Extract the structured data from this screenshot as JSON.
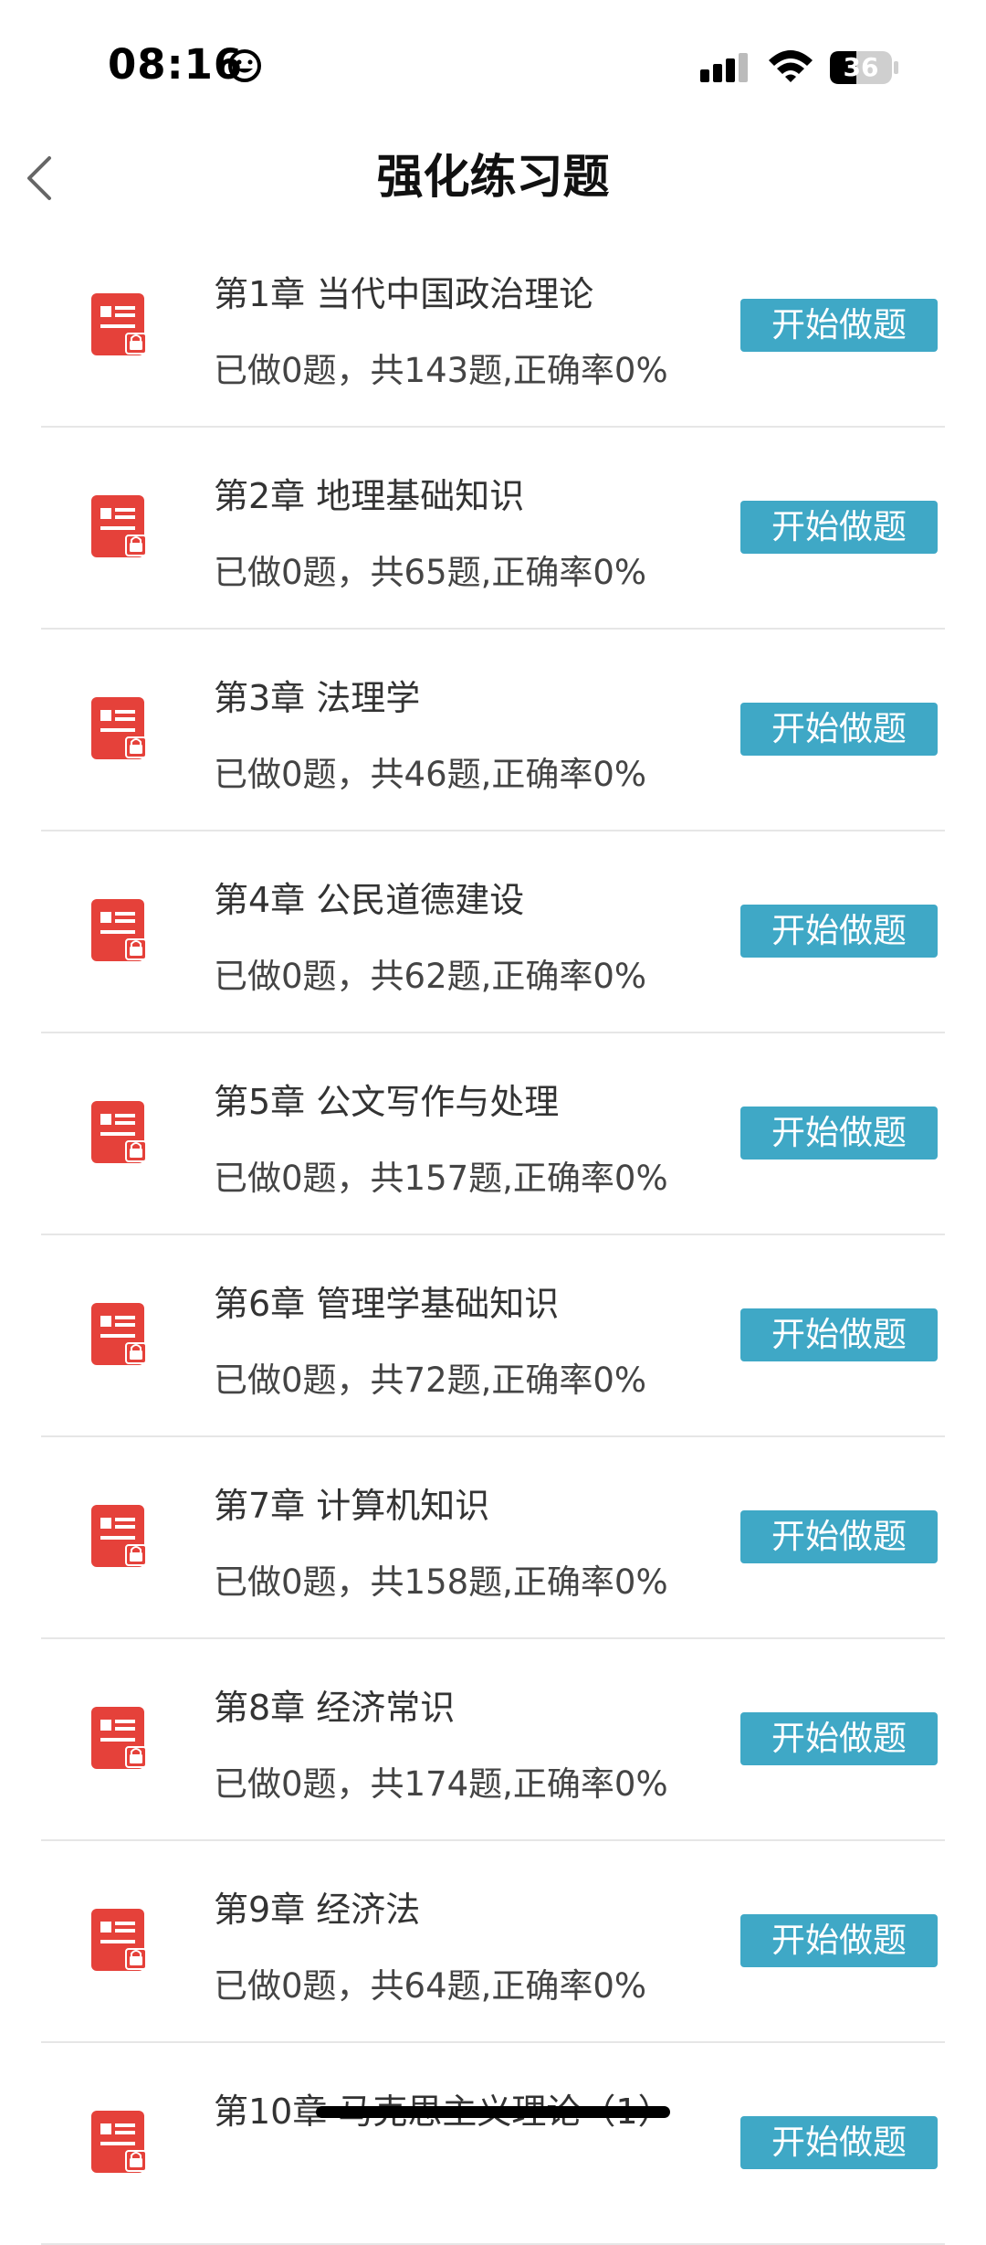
{
  "status_bar": {
    "time": "08:16",
    "battery_level": "36",
    "icons": [
      "smiley-icon",
      "cellular-signal-icon",
      "wifi-icon",
      "battery-icon"
    ]
  },
  "header": {
    "title": "强化练习题",
    "back_icon": "chevron-left-icon"
  },
  "colors": {
    "accent_button": "#3fa8c6",
    "icon_red": "#e5413a"
  },
  "chapters": [
    {
      "title": "第1章  当代中国政治理论",
      "stats": "已做0题，共143题,正确率0%",
      "button": "开始做题"
    },
    {
      "title": "第2章  地理基础知识",
      "stats": "已做0题，共65题,正确率0%",
      "button": "开始做题"
    },
    {
      "title": "第3章  法理学",
      "stats": "已做0题，共46题,正确率0%",
      "button": "开始做题"
    },
    {
      "title": "第4章  公民道德建设",
      "stats": "已做0题，共62题,正确率0%",
      "button": "开始做题"
    },
    {
      "title": "第5章  公文写作与处理",
      "stats": "已做0题，共157题,正确率0%",
      "button": "开始做题"
    },
    {
      "title": "第6章  管理学基础知识",
      "stats": "已做0题，共72题,正确率0%",
      "button": "开始做题"
    },
    {
      "title": "第7章  计算机知识",
      "stats": "已做0题，共158题,正确率0%",
      "button": "开始做题"
    },
    {
      "title": "第8章  经济常识",
      "stats": "已做0题，共174题,正确率0%",
      "button": "开始做题"
    },
    {
      "title": "第9章  经济法",
      "stats": "已做0题，共64题,正确率0%",
      "button": "开始做题"
    },
    {
      "title": "第10章  马克思主义理论（1）",
      "stats": "",
      "button": "开始做题"
    }
  ]
}
